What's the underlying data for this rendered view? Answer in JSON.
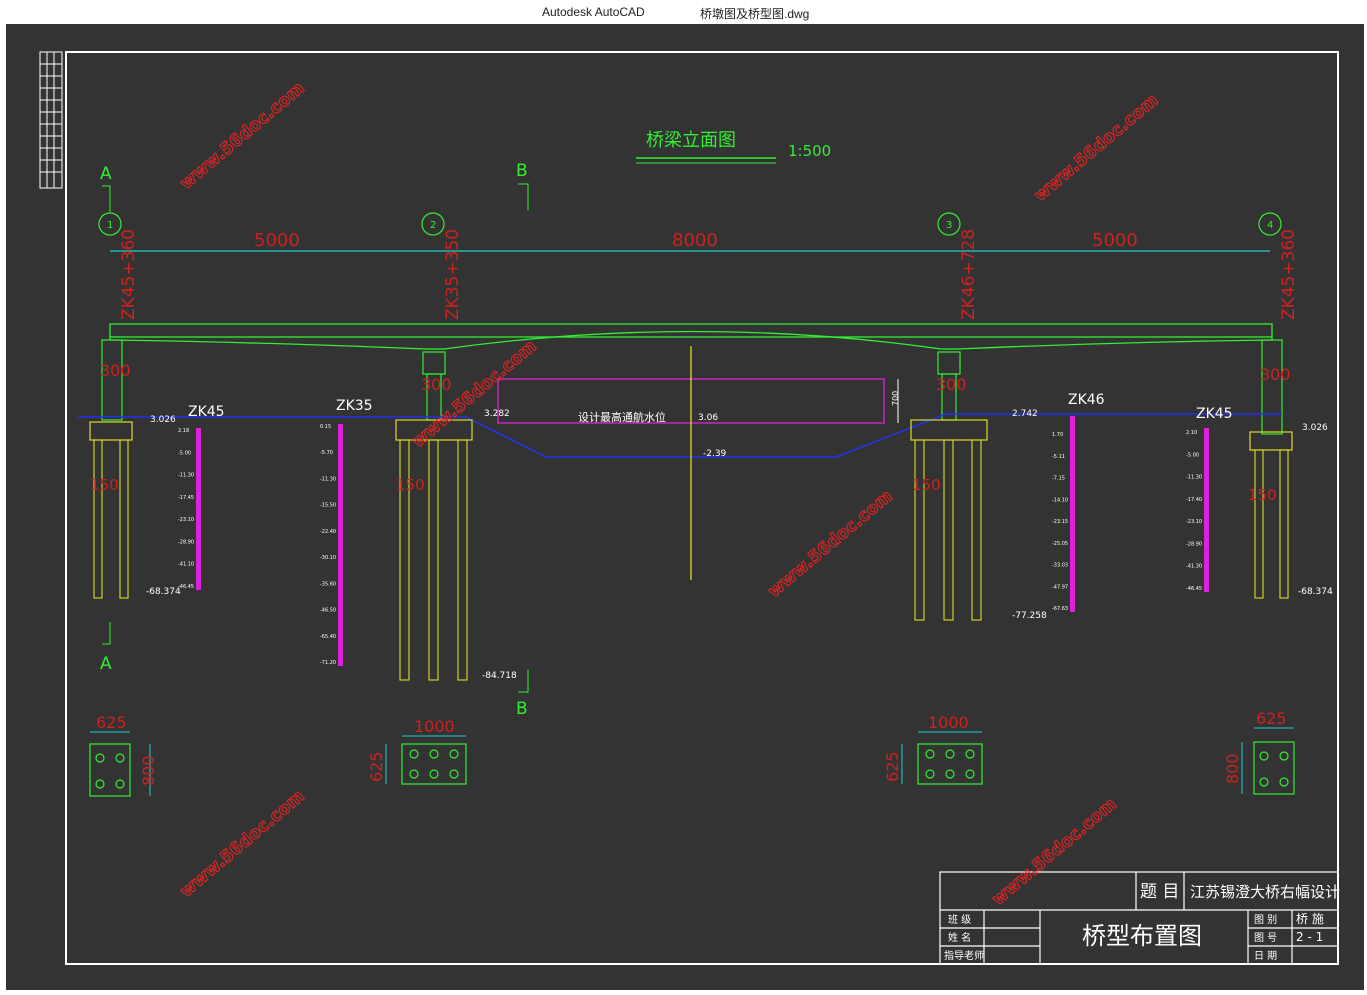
{
  "window": {
    "app_name": "Autodesk AutoCAD",
    "file_name": "桥墩图及桥型图.dwg"
  },
  "drawing": {
    "view_title": "桥梁立面图",
    "scale": "1:500",
    "watermark": "www.56doc.com",
    "section_a": "A",
    "section_b": "B",
    "axis_labels": [
      "1",
      "2",
      "3",
      "4"
    ],
    "spans": [
      "5000",
      "8000",
      "5000"
    ],
    "stations": [
      "ZK45+360",
      "ZK35+350",
      "ZK46+728",
      "ZK45+360"
    ],
    "pier_width_labels": [
      "300",
      "300",
      "300",
      "300"
    ],
    "boreholes": [
      "ZK45",
      "ZK35",
      "ZK46",
      "ZK45"
    ],
    "water_level_label": "设计最高通航水位",
    "navigation_clearance": "700",
    "elevations": {
      "ground_left": "3.026",
      "ground_pier2": "3.282",
      "water_level": "3.06",
      "river_bed": "-2.39",
      "ground_pier3": "2.742",
      "ground_right": "3.026",
      "pile_tip_1": "-68.374",
      "pile_tip_2": "-84.718",
      "pile_tip_3": "-77.258",
      "pile_tip_4": "-68.374"
    },
    "pile_spacing_labels": [
      "150",
      "150",
      "150",
      "150"
    ],
    "cap_plans": [
      {
        "width": "625",
        "height": "800"
      },
      {
        "width": "1000",
        "height": "625"
      },
      {
        "width": "1000",
        "height": "625"
      },
      {
        "width": "625",
        "height": "800"
      }
    ],
    "borehole_depths": {
      "zk45_left": [
        "2.18",
        "-5.00",
        "-11.30",
        "-17.45",
        "-23.10",
        "-28.90",
        "-41.10",
        "-46.45"
      ],
      "zk35": [
        "0.15",
        "-5.70",
        "-11.30",
        "-15.50",
        "-22.40",
        "-30.10",
        "-35.60",
        "-46.50",
        "-65.40",
        "-71.20"
      ],
      "zk46": [
        "1.70",
        "-5.11",
        "-7.15",
        "-14.10",
        "-23.15",
        "-25.05",
        "-33.03",
        "-47.97",
        "-67.63"
      ],
      "zk45_right": [
        "2.10",
        "-5.00",
        "-11.30",
        "-17.40",
        "-23.10",
        "-28.90",
        "-41.30",
        "-46.45"
      ]
    }
  },
  "title_block": {
    "topic_label": "题  目",
    "topic_value": "江苏锡澄大桥右幅设计",
    "drawing_name": "桥型布置图",
    "rows_left": [
      "班  级",
      "姓  名",
      "指导老师"
    ],
    "rows_right": [
      {
        "label": "图  别",
        "value": "桥  施"
      },
      {
        "label": "图  号",
        "value": "2 - 1"
      },
      {
        "label": "日  期",
        "value": ""
      }
    ]
  }
}
